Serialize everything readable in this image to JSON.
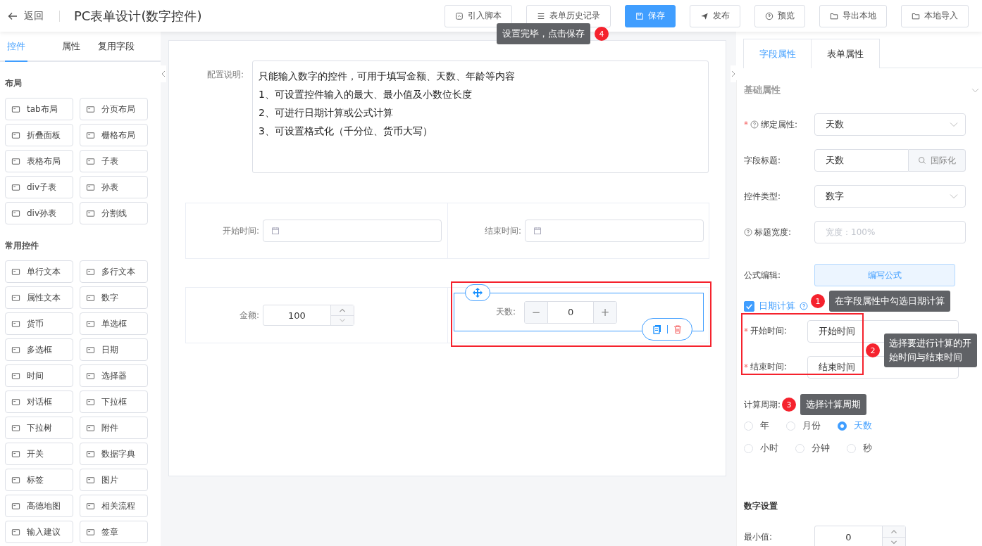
{
  "header": {
    "back": "返回",
    "title": "PC表单设计(数字控件)",
    "buttons": [
      {
        "label": "引入脚本",
        "kind": "default"
      },
      {
        "label": "表单历史记录",
        "kind": "default"
      },
      {
        "label": "保存",
        "kind": "primary"
      },
      {
        "label": "发布",
        "kind": "default"
      },
      {
        "label": "预览",
        "kind": "default"
      },
      {
        "label": "导出本地",
        "kind": "default"
      },
      {
        "label": "本地导入",
        "kind": "default"
      }
    ]
  },
  "save_tip": {
    "badge": "4",
    "text": "设置完毕，点击保存"
  },
  "left_panel": {
    "tabs": [
      {
        "label": "控件",
        "selected": true
      },
      {
        "label": "属性",
        "selected": false
      },
      {
        "label": "复用字段",
        "selected": false
      }
    ],
    "sections": [
      {
        "title": "布局",
        "items": [
          "tab布局",
          "分页布局",
          "折叠面板",
          "栅格布局",
          "表格布局",
          "子表",
          "div子表",
          "孙表",
          "div孙表",
          "分割线"
        ]
      },
      {
        "title": "常用控件",
        "items": [
          "单行文本",
          "多行文本",
          "属性文本",
          "数字",
          "货币",
          "单选框",
          "多选框",
          "日期",
          "时间",
          "选择器",
          "对话框",
          "下拉框",
          "下拉树",
          "附件",
          "开关",
          "数据字典",
          "标签",
          "图片",
          "高德地图",
          "相关流程",
          "输入建议",
          "签章"
        ]
      }
    ]
  },
  "canvas": {
    "description": {
      "label": "配置说明:",
      "lines": [
        "只能输入数字的控件，可用于填写金额、天数、年龄等内容",
        "1、可设置控件输入的最大、最小值及小数位长度",
        "2、可进行日期计算或公式计算",
        "3、可设置格式化（千分位、货币大写）"
      ]
    },
    "date_fields": [
      {
        "label": "开始时间:"
      },
      {
        "label": "结束时间:"
      }
    ],
    "amount": {
      "label": "金额:",
      "value": "100"
    },
    "days": {
      "label": "天数:",
      "value": "0",
      "minus": "−",
      "plus": "+",
      "selected": true
    }
  },
  "properties": {
    "tabs": [
      {
        "label": "字段属性",
        "selected": true
      },
      {
        "label": "表单属性",
        "selected": false
      }
    ],
    "section": "基础属性",
    "fields": [
      {
        "kind": "select",
        "label": "绑定属性:",
        "mark": "*",
        "help": true,
        "value": "天数"
      },
      {
        "kind": "i18n",
        "label": "字段标题:",
        "help": false,
        "value": "天数",
        "button": "国际化"
      },
      {
        "kind": "select",
        "label": "控件类型:",
        "help": false,
        "value": "数字"
      },
      {
        "kind": "input",
        "label": "标题宽度:",
        "help": true,
        "placeholder": "宽度：100%"
      },
      {
        "kind": "button",
        "label": "公式编辑:",
        "help": false,
        "button": "编写公式"
      }
    ],
    "date_calc": {
      "label": "日期计算",
      "checked": true
    },
    "tip1": {
      "badge": "1",
      "text": "在字段属性中勾选日期计算"
    },
    "range": [
      {
        "label": "开始时间:",
        "mark": "*",
        "value": "开始时间"
      },
      {
        "label": "结束时间:",
        "mark": "*",
        "value": "结束时间"
      }
    ],
    "tip2": {
      "badge": "2",
      "text": "选择要进行计算的开始时间与结束时间"
    },
    "period": {
      "label": "计算周期:",
      "options": [
        [
          {
            "label": "年",
            "selected": false
          },
          {
            "label": "月份",
            "selected": false
          },
          {
            "label": "天数",
            "selected": true
          }
        ],
        [
          {
            "label": "小时",
            "selected": false
          },
          {
            "label": "分钟",
            "selected": false
          },
          {
            "label": "秒",
            "selected": false
          }
        ]
      ]
    },
    "tip3": {
      "badge": "3",
      "text": "选择计算周期"
    },
    "number_settings": {
      "title": "数字设置",
      "min_label": "最小值:",
      "min_value": "0"
    }
  }
}
